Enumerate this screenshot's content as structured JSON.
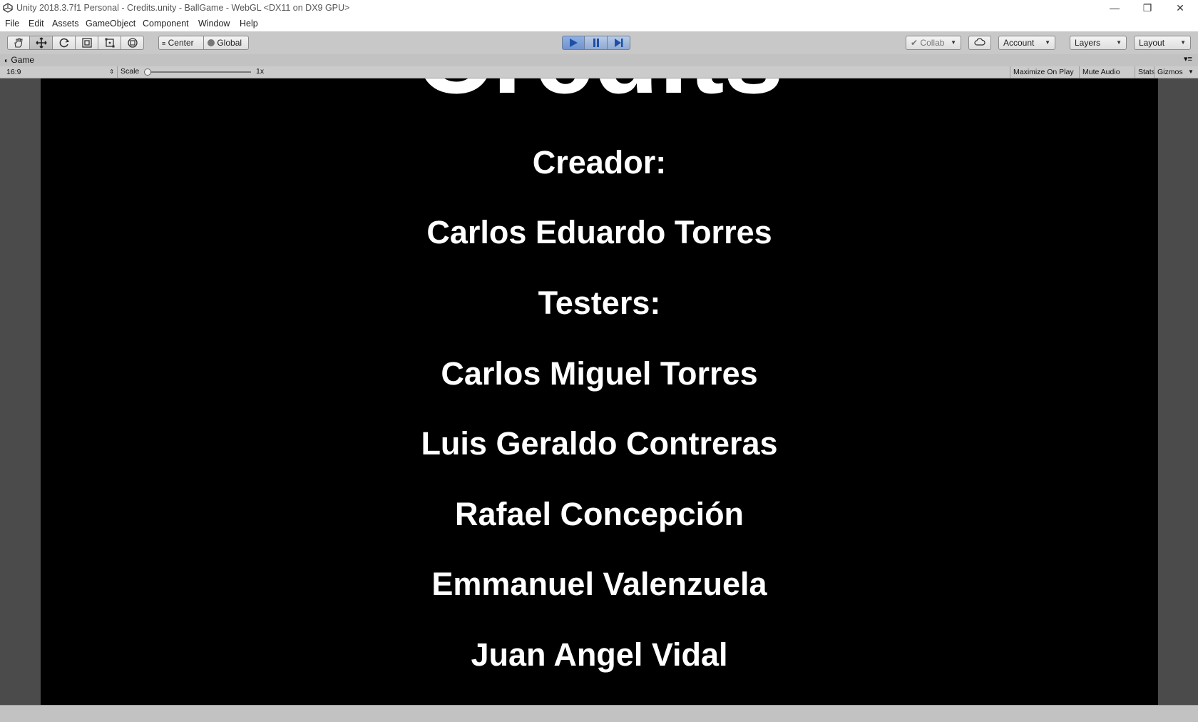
{
  "window": {
    "title": "Unity 2018.3.7f1 Personal - Credits.unity - BallGame - WebGL <DX11 on DX9 GPU>",
    "minimize_glyph": "—",
    "restore_glyph": "❐",
    "close_glyph": "✕"
  },
  "menu": [
    "File",
    "Edit",
    "Assets",
    "GameObject",
    "Component",
    "Window",
    "Help"
  ],
  "toolbar": {
    "pivot_mode": "Center",
    "pivot_rotation": "Global",
    "collab_label": "Collab",
    "account_label": "Account",
    "layers_label": "Layers",
    "layout_label": "Layout",
    "play_state": "playing"
  },
  "game_tab": {
    "tab_label": "Game",
    "aspect": "16:9",
    "scale_label": "Scale",
    "scale_value": "1x",
    "maximize_on_play": "Maximize On Play",
    "mute_audio": "Mute Audio",
    "stats": "Stats",
    "gizmos": "Gizmos"
  },
  "credits": {
    "title": "Credits",
    "lines": [
      "Creador:",
      "Carlos Eduardo Torres",
      "Testers:",
      "Carlos Miguel Torres",
      "Luis Geraldo Contreras",
      "Rafael Concepción",
      "Emmanuel Valenzuela",
      "Juan Angel Vidal"
    ]
  },
  "colors": {
    "game_background": "#000000",
    "credit_text": "#ffffff",
    "play_active": "#6f93cf"
  }
}
